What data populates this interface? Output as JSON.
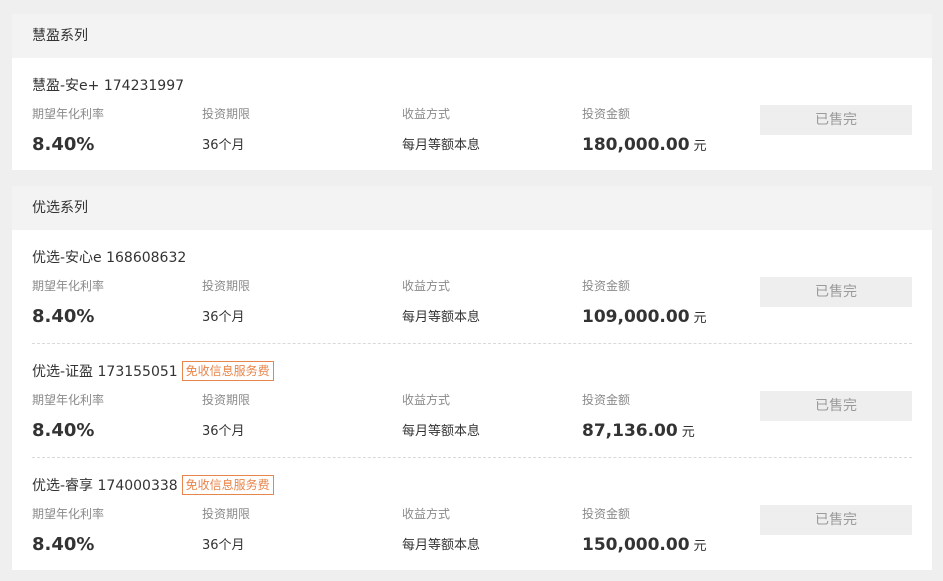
{
  "series": [
    {
      "title": "慧盈系列",
      "products": [
        {
          "name": "慧盈-安e+ 174231997",
          "tag": "",
          "rate_label": "期望年化利率",
          "rate": "8.40%",
          "term_label": "投资期限",
          "term": "36个月",
          "pay_label": "收益方式",
          "pay": "每月等额本息",
          "amount_label": "投资金额",
          "amount": "180,000.00",
          "unit": "元",
          "button": "已售完"
        }
      ]
    },
    {
      "title": "优选系列",
      "products": [
        {
          "name": "优选-安心e 168608632",
          "tag": "",
          "rate_label": "期望年化利率",
          "rate": "8.40%",
          "term_label": "投资期限",
          "term": "36个月",
          "pay_label": "收益方式",
          "pay": "每月等额本息",
          "amount_label": "投资金额",
          "amount": "109,000.00",
          "unit": "元",
          "button": "已售完"
        },
        {
          "name": "优选-证盈 173155051",
          "tag": "免收信息服务费",
          "rate_label": "期望年化利率",
          "rate": "8.40%",
          "term_label": "投资期限",
          "term": "36个月",
          "pay_label": "收益方式",
          "pay": "每月等额本息",
          "amount_label": "投资金额",
          "amount": "87,136.00",
          "unit": "元",
          "button": "已售完"
        },
        {
          "name": "优选-睿享 174000338",
          "tag": "免收信息服务费",
          "rate_label": "期望年化利率",
          "rate": "8.40%",
          "term_label": "投资期限",
          "term": "36个月",
          "pay_label": "收益方式",
          "pay": "每月等额本息",
          "amount_label": "投资金额",
          "amount": "150,000.00",
          "unit": "元",
          "button": "已售完"
        }
      ]
    }
  ],
  "colors": {
    "tag": "#e8854a",
    "button_bg": "#eeeeee",
    "page_bg": "#efefef"
  }
}
